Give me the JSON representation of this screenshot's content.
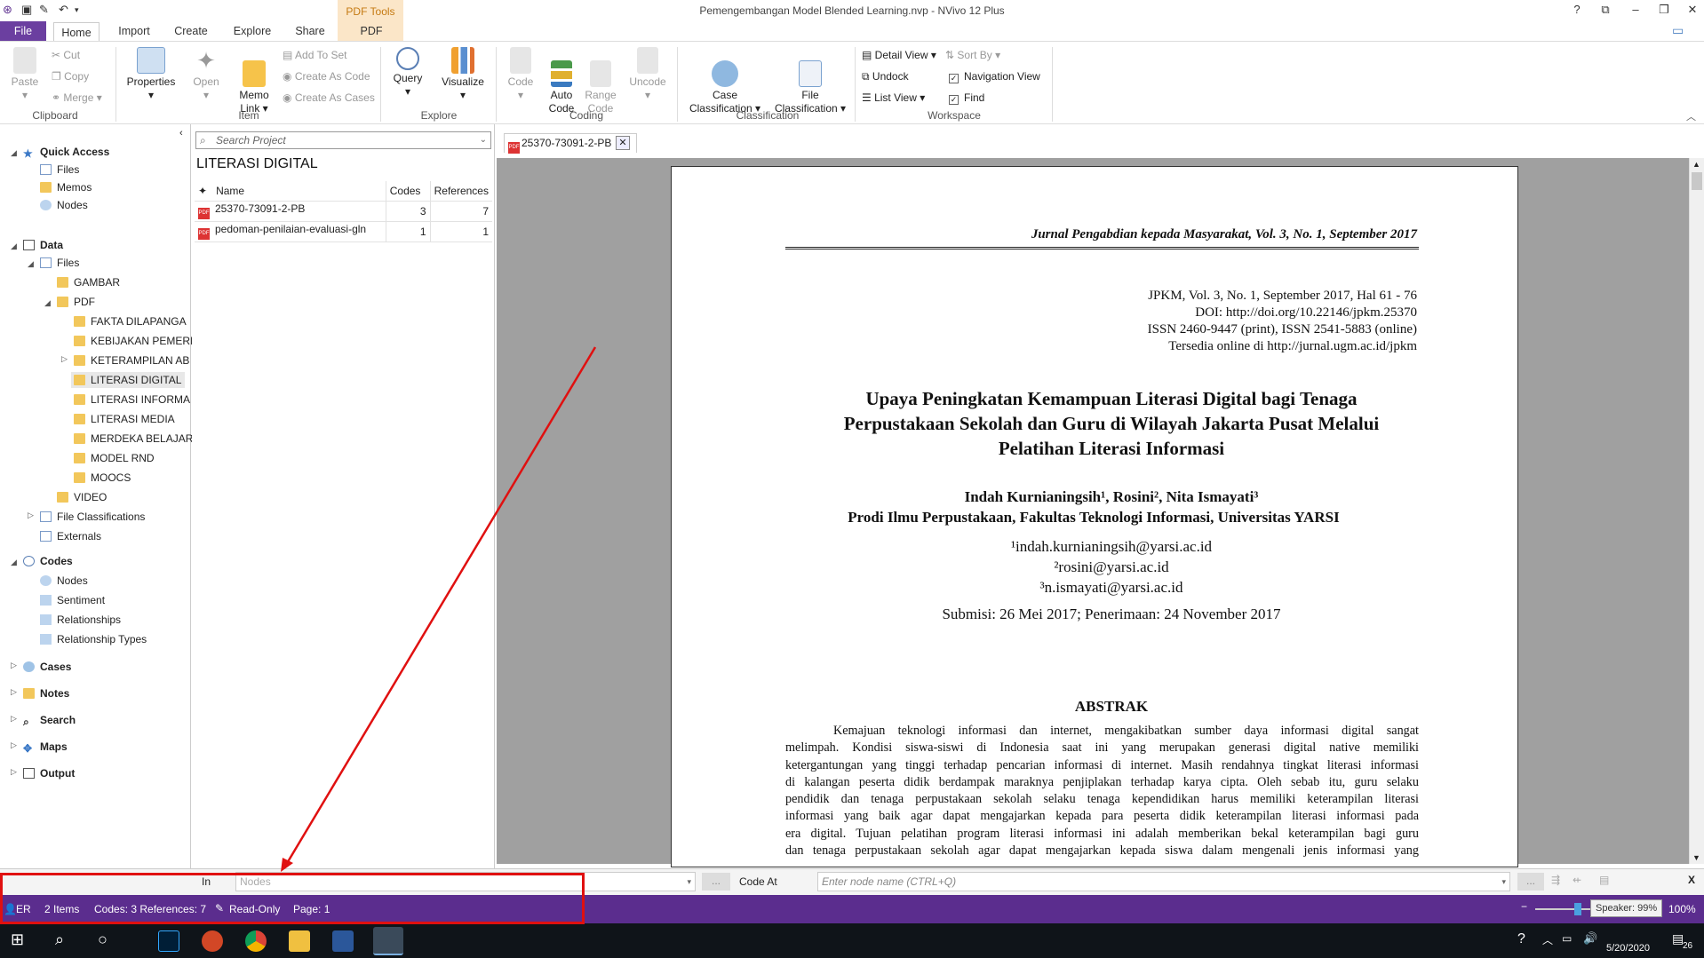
{
  "window": {
    "title": "Pemengembangan Model Blended Learning.nvp - NVivo 12 Plus",
    "help": "?",
    "min": "–",
    "max": "❐",
    "close": "✕"
  },
  "ribbon": {
    "tabs": [
      "File",
      "Home",
      "Import",
      "Create",
      "Explore",
      "Share",
      "PDF"
    ],
    "context_tab_group": "PDF Tools",
    "clipboard": {
      "paste": "Paste",
      "cut": "Cut",
      "copy": "Copy",
      "merge": "Merge",
      "group": "Clipboard"
    },
    "item": {
      "properties": "Properties",
      "open": "Open",
      "memo_link": "Memo\nLink",
      "add_to_set": "Add To Set",
      "create_as_code": "Create As Code",
      "create_as_cases": "Create As Cases",
      "group": "Item"
    },
    "explore": {
      "query": "Query",
      "visualize": "Visualize",
      "group": "Explore"
    },
    "coding": {
      "code": "Code",
      "auto_code": "Auto\nCode",
      "range_code": "Range\nCode",
      "uncode": "Uncode",
      "group": "Coding"
    },
    "classification": {
      "case": "Case\nClassification",
      "file": "File\nClassification",
      "group": "Classification"
    },
    "workspace": {
      "detail_view": "Detail View",
      "sort_by": "Sort By",
      "undock": "Undock",
      "navigation_view": "Navigation View",
      "list_view": "List View",
      "find": "Find",
      "group": "Workspace"
    }
  },
  "nav": {
    "quick_access": "Quick Access",
    "qa_items": [
      "Files",
      "Memos",
      "Nodes"
    ],
    "data": "Data",
    "files": "Files",
    "folders": [
      "GAMBAR",
      "PDF"
    ],
    "pdf_sub": [
      "FAKTA DILAPANGA",
      "KEBIJAKAN PEMERI",
      "KETERAMPILAN AB",
      "LITERASI DIGITAL",
      "LITERASI INFORMA",
      "LITERASI MEDIA",
      "MERDEKA BELAJAR",
      "MODEL RND",
      "MOOCS"
    ],
    "video": "VIDEO",
    "file_classifications": "File Classifications",
    "externals": "Externals",
    "codes": "Codes",
    "codes_items": [
      "Nodes",
      "Sentiment",
      "Relationships",
      "Relationship Types"
    ],
    "cases": "Cases",
    "notes": "Notes",
    "search": "Search",
    "maps": "Maps",
    "output": "Output"
  },
  "list": {
    "search_placeholder": "Search Project",
    "title": "LITERASI DIGITAL",
    "columns": [
      "Name",
      "Codes",
      "References"
    ],
    "rows": [
      {
        "name": "25370-73091-2-PB",
        "codes": "3",
        "refs": "7"
      },
      {
        "name": "pedoman-penilaian-evaluasi-gln",
        "codes": "1",
        "refs": "1"
      }
    ]
  },
  "doc": {
    "tab_label": "25370-73091-2-PB",
    "journal": "Jurnal Pengabdian kepada Masyarakat, Vol. 3, No. 1, September 2017",
    "meta": [
      "JPKM, Vol. 3, No. 1, September 2017, Hal 61 - 76",
      "DOI: http://doi.org/10.22146/jpkm.25370",
      "ISSN 2460-9447 (print), ISSN 2541-5883 (online)",
      "Tersedia online di http://jurnal.ugm.ac.id/jpkm"
    ],
    "title": [
      "Upaya Peningkatan Kemampuan Literasi Digital bagi Tenaga",
      "Perpustakaan Sekolah dan Guru  di Wilayah Jakarta Pusat Melalui",
      "Pelatihan Literasi Informasi"
    ],
    "authors": "Indah Kurnianingsih¹, Rosini², Nita Ismayati³",
    "affiliation": "Prodi Ilmu Perpustakaan, Fakultas Teknologi Informasi, Universitas YARSI",
    "emails": [
      "¹indah.kurnianingsih@yarsi.ac.id",
      "²rosini@yarsi.ac.id",
      "³n.ismayati@yarsi.ac.id"
    ],
    "dates": "Submisi: 26 Mei 2017; Penerimaan: 24 November 2017",
    "abstract_heading": "ABSTRAK",
    "abstract_lines": [
      "Kemajuan teknologi informasi dan internet, mengakibatkan sumber daya informasi digital sangat",
      "melimpah. Kondisi siswa-siswi di Indonesia saat ini yang merupakan generasi digital native memiliki",
      "ketergantungan yang tinggi terhadap pencarian informasi di internet. Masih rendahnya tingkat literasi informasi",
      "di kalangan peserta didik berdampak maraknya penjiplakan terhadap karya cipta. Oleh sebab itu, guru selaku",
      "pendidik dan tenaga perpustakaan sekolah selaku tenaga kependidikan harus memiliki keterampilan literasi",
      "informasi yang baik agar dapat mengajarkan kepada para peserta didik keterampilan literasi informasi pada",
      "era digital. Tujuan pelatihan program literasi informasi ini adalah memberikan bekal keterampilan bagi guru",
      "dan tenaga perpustakaan sekolah agar dapat mengajarkan kepada siswa dalam mengenali jenis informasi yang"
    ]
  },
  "codebar": {
    "in_label": "In",
    "nodes_placeholder": "Nodes",
    "dots": "...",
    "code_at": "Code At",
    "node_placeholder": "Enter node name (CTRL+Q)",
    "close": "X"
  },
  "status": {
    "user": "ER",
    "items": "2 Items",
    "codes_refs": "Codes: 3  References: 7",
    "readonly": "Read-Only",
    "page": "Page: 1",
    "zoom": "100%"
  },
  "taskbar": {
    "tooltip": "Speaker: 99%",
    "date": "5/20/2020",
    "badge": "26"
  }
}
